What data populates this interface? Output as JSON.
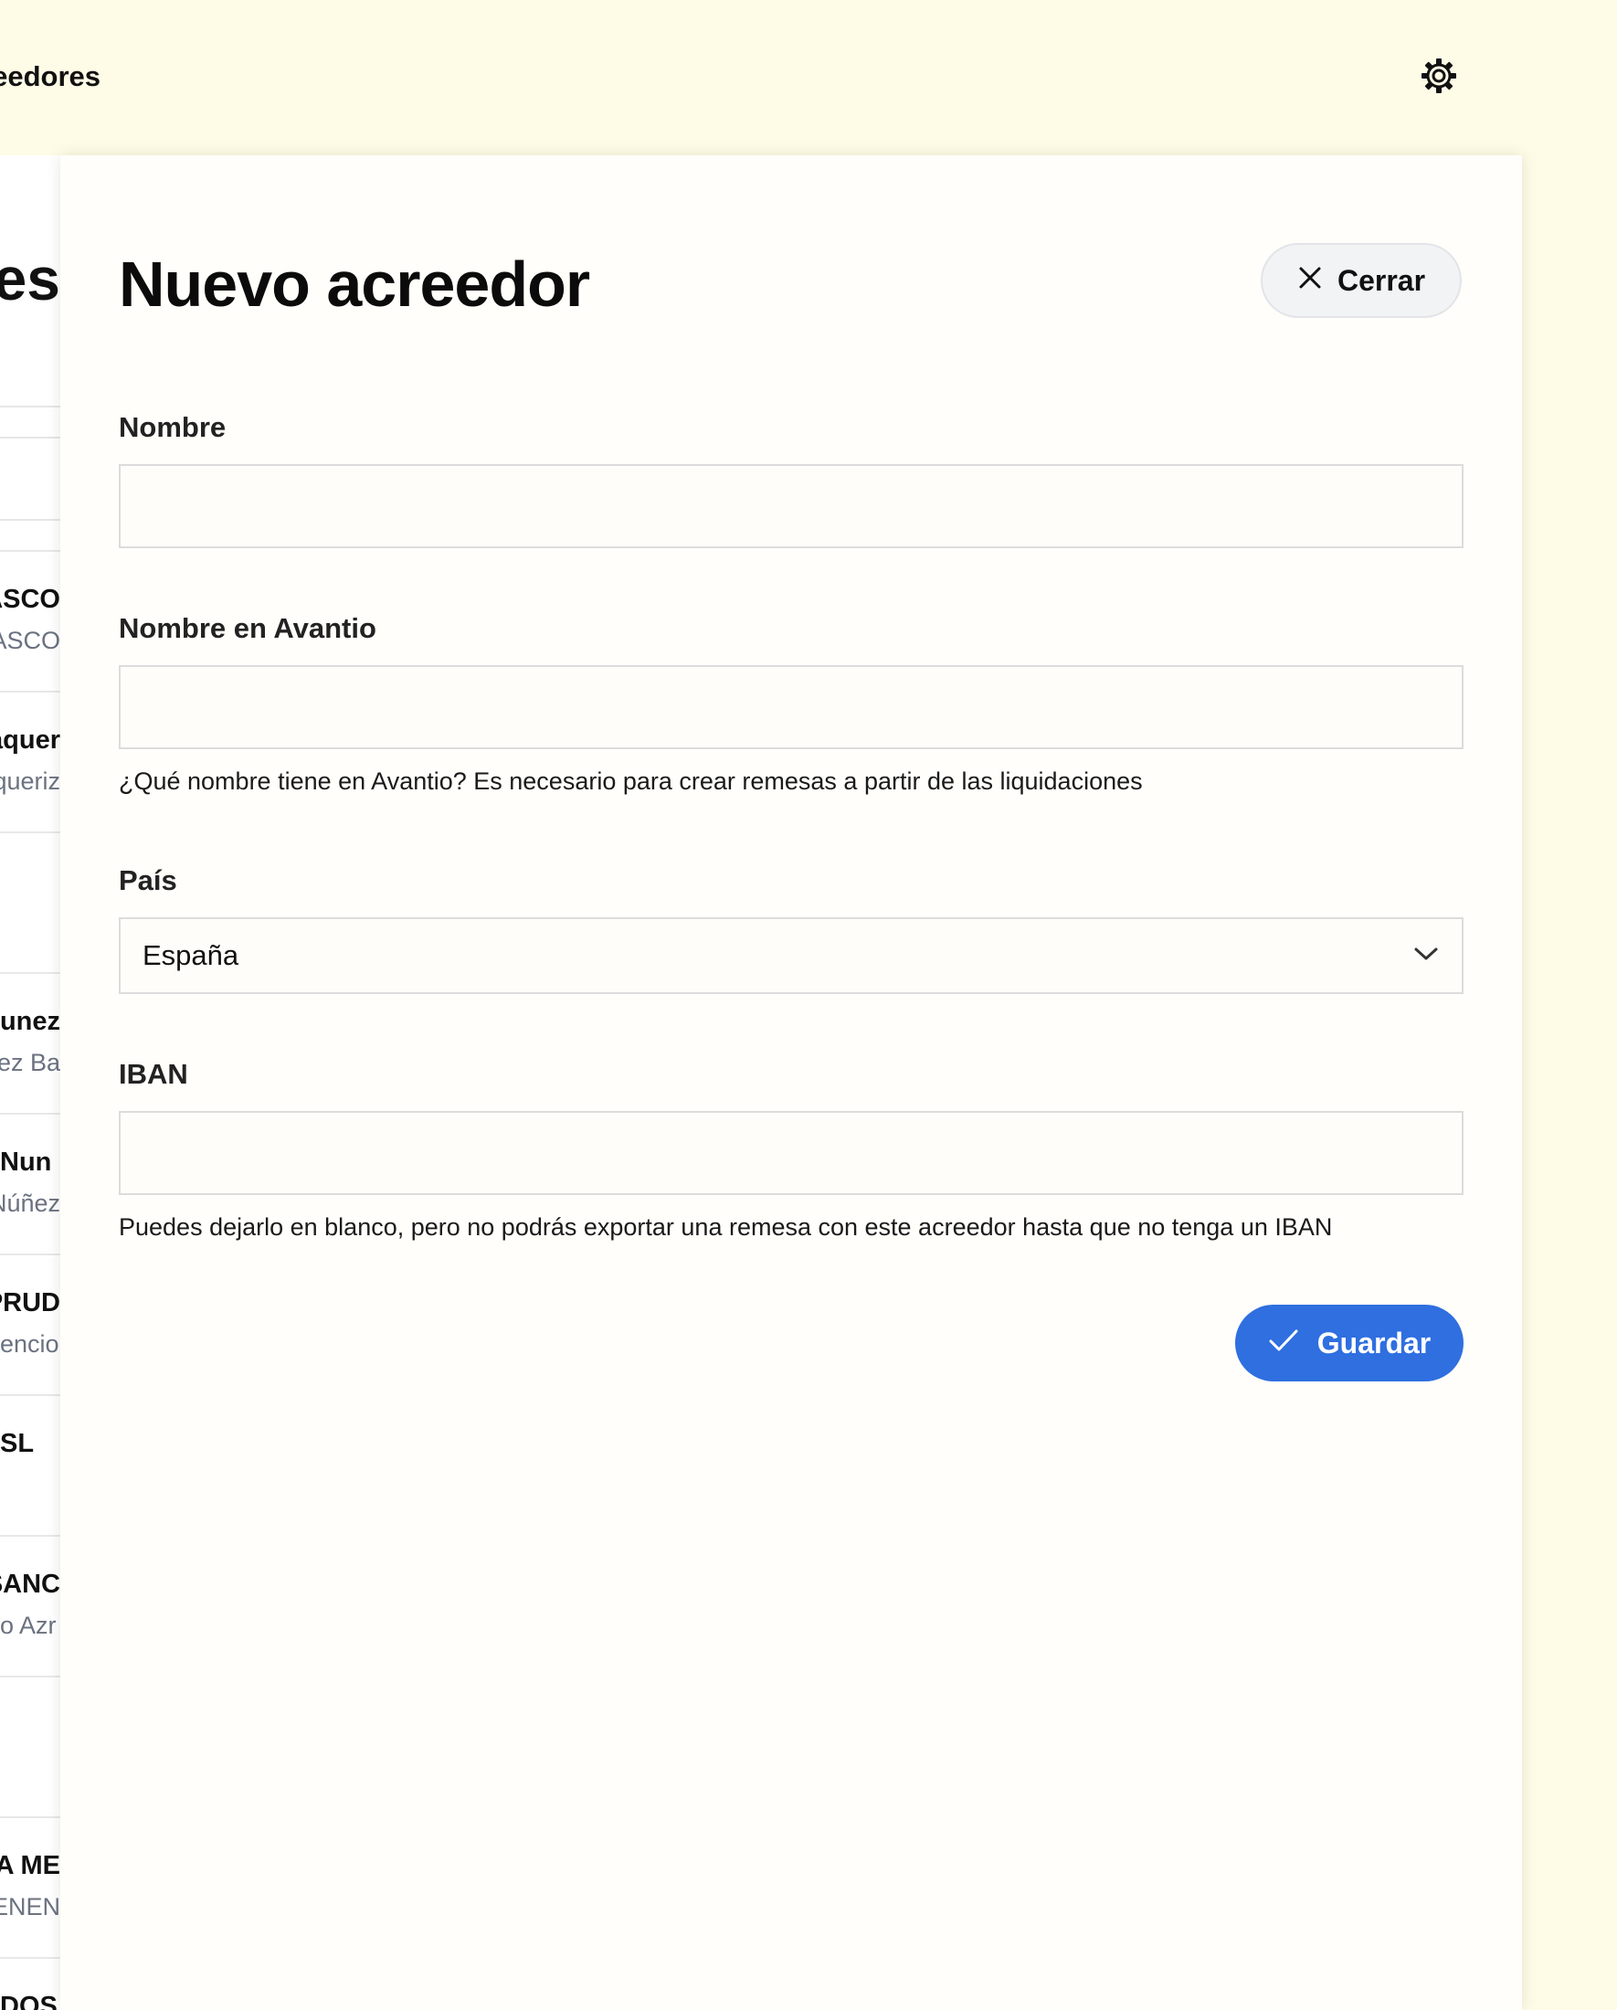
{
  "background": {
    "topbar_title": "Acreedores",
    "page_heading": "Acreedores",
    "list_items": [
      {
        "title": "",
        "subtitle": ""
      },
      {
        "title": "CASCO",
        "subtitle": "CASCO"
      },
      {
        "title": "Vaquer",
        "subtitle": "Vaqueriz"
      },
      {
        "title": "",
        "subtitle": ""
      },
      {
        "title": "Nunez",
        "subtitle": "Núñez Ba"
      },
      {
        "title": "Nun",
        "subtitle": "Núñez"
      },
      {
        "title": "PRUD",
        "subtitle": "encio"
      },
      {
        "title": "SL",
        "subtitle": ""
      },
      {
        "title": "SANC",
        "subtitle": "o Azr"
      },
      {
        "title": "",
        "subtitle": ""
      },
      {
        "title": "A ME",
        "subtitle": "ENEN"
      },
      {
        "title": "DOS",
        "subtitle": ""
      }
    ]
  },
  "modal": {
    "title": "Nuevo acreedor",
    "close_label": "Cerrar",
    "fields": {
      "nombre": {
        "label": "Nombre",
        "value": "",
        "placeholder": ""
      },
      "nombre_avantio": {
        "label": "Nombre en Avantio",
        "value": "",
        "placeholder": "",
        "help": "¿Qué nombre tiene en Avantio? Es necesario para crear remesas a partir de las liquidaciones"
      },
      "pais": {
        "label": "País",
        "selected": "España"
      },
      "iban": {
        "label": "IBAN",
        "value": "",
        "placeholder": "",
        "help": "Puedes dejarlo en blanco, pero no podrás exportar una remesa con este acreedor hasta que no tenga un IBAN"
      }
    },
    "save_label": "Guardar"
  },
  "icons": {
    "settings": "gear-icon",
    "close": "close-icon",
    "select": "chevron-down-icon",
    "save": "check-icon"
  },
  "colors": {
    "page_bg": "#fefbe6",
    "panel_bg": "#fffefa",
    "primary": "#2f6fe0",
    "close_bg": "#f2f3f5"
  }
}
